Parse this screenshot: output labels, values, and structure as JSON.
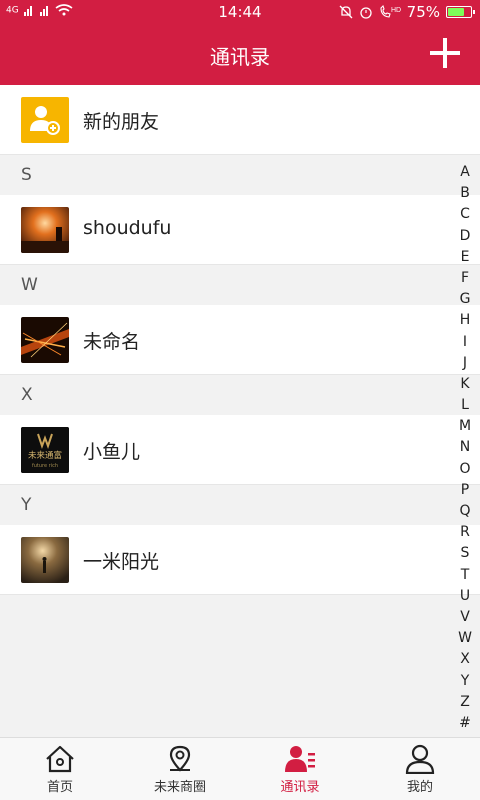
{
  "status_bar": {
    "network": "4G",
    "time": "14:44",
    "hd": "HD",
    "battery": "75%",
    "battery_level": 0.75
  },
  "header": {
    "title": "通讯录",
    "add_icon": "plus-icon"
  },
  "new_friends": {
    "label": "新的朋友",
    "icon": "add-user-icon",
    "color": "#f7b500"
  },
  "sections": [
    {
      "letter": "S",
      "contacts": [
        {
          "name": "shoudufu"
        }
      ]
    },
    {
      "letter": "W",
      "contacts": [
        {
          "name": "未命名"
        }
      ]
    },
    {
      "letter": "X",
      "contacts": [
        {
          "name": "小鱼儿",
          "avatar_text": "未来通富",
          "avatar_sub": "future rich"
        }
      ]
    },
    {
      "letter": "Y",
      "contacts": [
        {
          "name": "一米阳光"
        }
      ]
    }
  ],
  "index_letters": [
    "A",
    "B",
    "C",
    "D",
    "E",
    "F",
    "G",
    "H",
    "I",
    "J",
    "K",
    "L",
    "M",
    "N",
    "O",
    "P",
    "Q",
    "R",
    "S",
    "T",
    "U",
    "V",
    "W",
    "X",
    "Y",
    "Z",
    "#"
  ],
  "tabs": [
    {
      "label": "首页",
      "icon": "home-icon",
      "active": false
    },
    {
      "label": "未来商圈",
      "icon": "location-pin-icon",
      "active": false
    },
    {
      "label": "通讯录",
      "icon": "contacts-icon",
      "active": true
    },
    {
      "label": "我的",
      "icon": "person-icon",
      "active": false
    }
  ],
  "colors": {
    "brand": "#d21e42",
    "active_tab": "#d21e42"
  }
}
